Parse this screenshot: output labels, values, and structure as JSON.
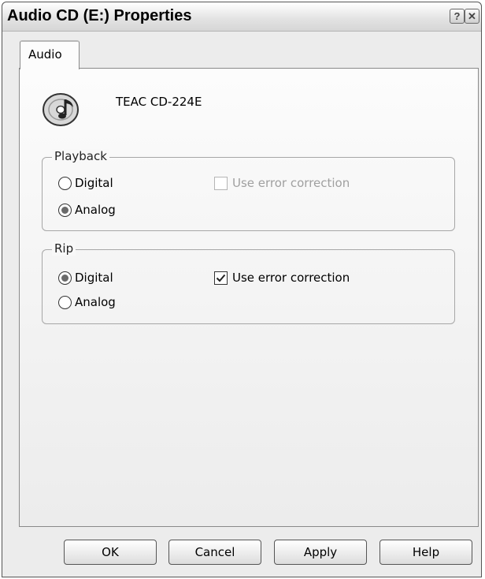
{
  "window": {
    "title": "Audio CD (E:) Properties",
    "help_button": "?",
    "close_button": "✕"
  },
  "tabs": [
    {
      "label": "Audio",
      "active": true
    }
  ],
  "device": {
    "name": "TEAC CD-224E",
    "icon": "cd-audio-icon"
  },
  "playback": {
    "legend": "Playback",
    "digital_label": "Digital",
    "analog_label": "Analog",
    "selected": "Analog",
    "error_correction_label": "Use error correction",
    "error_correction_checked": false,
    "error_correction_enabled": false
  },
  "rip": {
    "legend": "Rip",
    "digital_label": "Digital",
    "analog_label": "Analog",
    "selected": "Digital",
    "error_correction_label": "Use error correction",
    "error_correction_checked": true,
    "error_correction_enabled": true
  },
  "buttons": {
    "ok": "OK",
    "cancel": "Cancel",
    "apply": "Apply",
    "help": "Help"
  }
}
